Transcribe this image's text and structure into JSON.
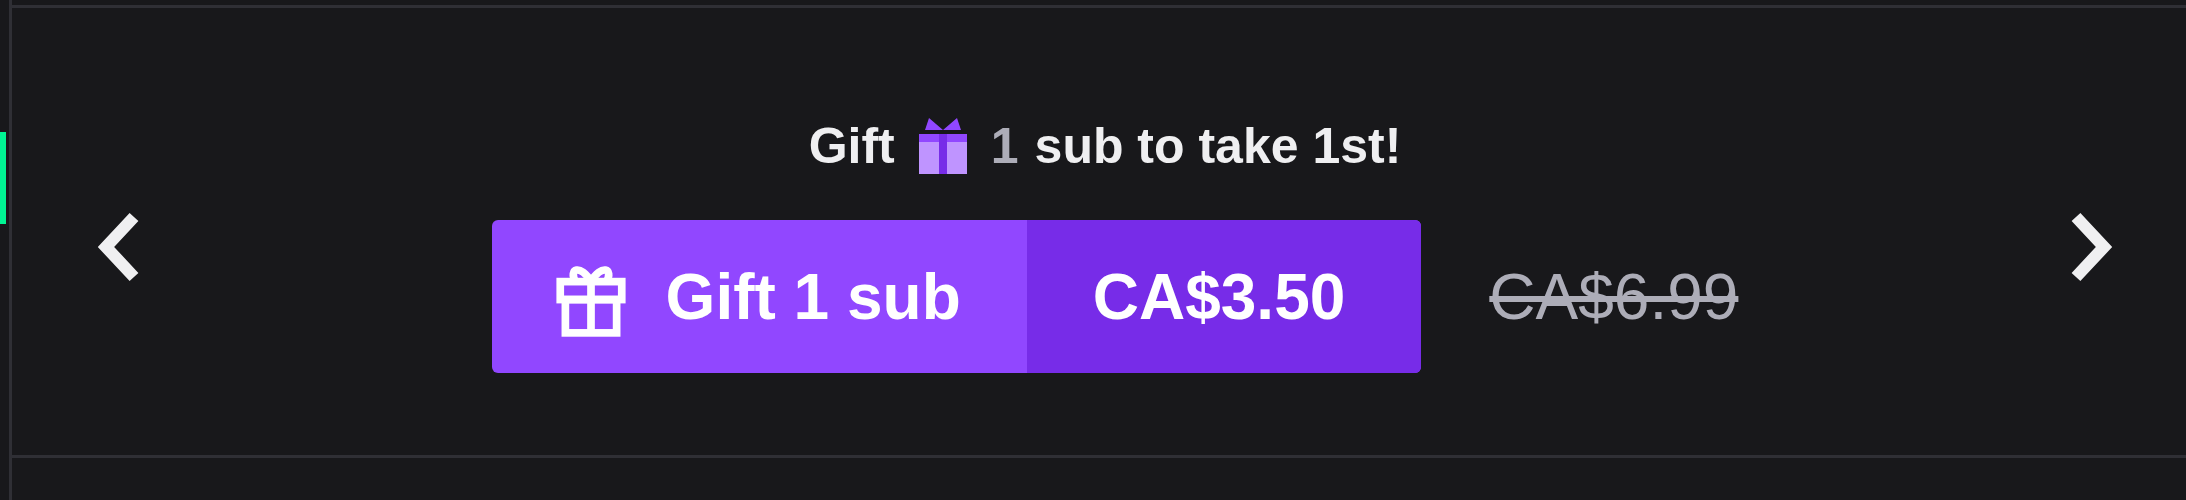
{
  "headline": {
    "prefix": "Gift",
    "count": "1",
    "suffix": "sub to take 1st!"
  },
  "gift_button": {
    "label": "Gift 1 sub",
    "price": "CA$3.50"
  },
  "original_price": "CA$6.99"
}
